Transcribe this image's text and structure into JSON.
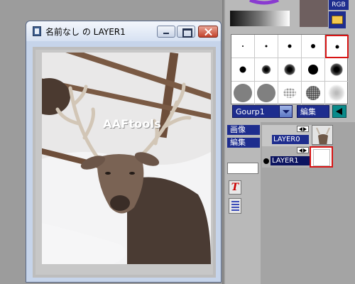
{
  "window": {
    "title": "名前なし の LAYER1",
    "watermark": "AAFtools"
  },
  "palette": {
    "mode_label": "RGB",
    "swatch_color": "#6e5f5f"
  },
  "brushes": {
    "group_value": "Gourp1",
    "edit_label": "編集",
    "selected_index": 4
  },
  "tools": {
    "image_label": "画像",
    "edit_label": "編集",
    "text_tool_glyph": "T"
  },
  "layers": [
    {
      "name": "LAYER0",
      "selected": false,
      "visible": false
    },
    {
      "name": "LAYER1",
      "selected": true,
      "visible": true
    }
  ],
  "colors": {
    "accent": "#1e2d8e",
    "selection": "#d71414",
    "teal": "#0a8a8a"
  }
}
